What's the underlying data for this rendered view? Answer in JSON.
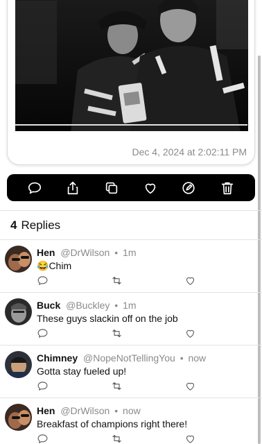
{
  "post": {
    "timestamp": "Dec 4, 2024 at 2:02:11 PM"
  },
  "action_bar": {
    "icons": [
      "comment-icon",
      "share-icon",
      "copy-icon",
      "like-icon",
      "edit-icon",
      "delete-icon"
    ]
  },
  "replies": {
    "count": "4",
    "label": "Replies",
    "items": [
      {
        "name": "Hen",
        "handle": "@DrWilson",
        "time": "1m",
        "emoji": "😂",
        "text": "Chim"
      },
      {
        "name": "Buck",
        "handle": "@Buckley",
        "time": "1m",
        "emoji": "",
        "text": "These guys slackin off on the job"
      },
      {
        "name": "Chimney",
        "handle": "@NopeNotTellingYou",
        "time": "now",
        "emoji": "",
        "text": "Gotta stay fueled up!"
      },
      {
        "name": "Hen",
        "handle": "@DrWilson",
        "time": "now",
        "emoji": "",
        "text": "Breakfast of champions right there!"
      }
    ]
  },
  "colors": {
    "action_bar_bg": "#000000",
    "secondary_text": "#8a8a8e"
  }
}
